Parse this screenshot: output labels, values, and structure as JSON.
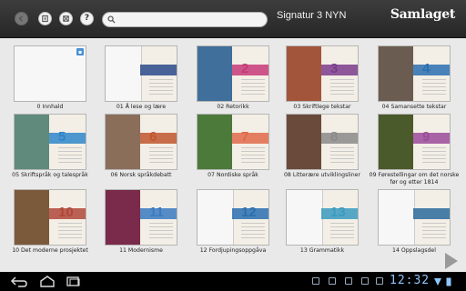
{
  "header": {
    "book_title": "Signatur 3 NYN",
    "brand": "Samlaget",
    "search": {
      "value": "",
      "placeholder": ""
    },
    "icons": [
      "back-icon",
      "bookmark-icon",
      "tools-icon",
      "help-icon"
    ],
    "help_glyph": "?"
  },
  "chapters": [
    {
      "label": "0 Innhald",
      "num": "",
      "style": "blank",
      "cover": "#f7f7f7",
      "accent": "#ffffff"
    },
    {
      "label": "01 Å lese og lære",
      "num": "",
      "style": "halfpage",
      "cover": "#f7f7f7",
      "accent": "#2a4a8a"
    },
    {
      "label": "02 Retorikk",
      "num": "2",
      "style": "photo",
      "cover": "#3f6f9a",
      "accent": "#c53a78"
    },
    {
      "label": "03 Skriftlege tekstar",
      "num": "3",
      "style": "photo",
      "cover": "#a2553a",
      "accent": "#7a3c8c"
    },
    {
      "label": "04 Samansette tekstar",
      "num": "4",
      "style": "photo",
      "cover": "#6a5c50",
      "accent": "#2a6fb0"
    },
    {
      "label": "05 Skriftspråk og talespråk",
      "num": "5",
      "style": "photo",
      "cover": "#5f8a7c",
      "accent": "#2f86c9"
    },
    {
      "label": "06 Norsk språkdebatt",
      "num": "6",
      "style": "photo",
      "cover": "#8a6e5a",
      "accent": "#c0562e"
    },
    {
      "label": "07 Nordiske språk",
      "num": "7",
      "style": "photo",
      "cover": "#4b7a3a",
      "accent": "#e06a4a"
    },
    {
      "label": "08 Litterære utviklingsliner",
      "num": "8",
      "style": "photo",
      "cover": "#6a4a3a",
      "accent": "#8a8a8a"
    },
    {
      "label": "09 Førestellingar om det norske før og etter 1814",
      "num": "9",
      "style": "photo",
      "cover": "#4a5a2a",
      "accent": "#9a4a9a"
    },
    {
      "label": "10 Det moderne prosjektet",
      "num": "10",
      "style": "photo",
      "cover": "#7a5a3a",
      "accent": "#b0463a"
    },
    {
      "label": "11 Modernisme",
      "num": "11",
      "style": "photo",
      "cover": "#7a2a4a",
      "accent": "#3a7ac0"
    },
    {
      "label": "12 Fordjupingsoppgåva",
      "num": "12",
      "style": "halfpage",
      "cover": "#f7f7f7",
      "accent": "#2a6fb0"
    },
    {
      "label": "13 Grammatikk",
      "num": "13",
      "style": "halfpage",
      "cover": "#f7f7f7",
      "accent": "#3a9ac0"
    },
    {
      "label": "14 Oppslagsdel",
      "num": "",
      "style": "halfpage",
      "cover": "#f7f7f7",
      "accent": "#2a6a9a"
    }
  ],
  "system_bar": {
    "clock": "12:32",
    "nav_icons": [
      "back-nav-icon",
      "home-nav-icon",
      "recent-apps-icon"
    ],
    "tray_icons": [
      "tray-checkbox-icon-1",
      "tray-checkbox-icon-2",
      "tray-checkbox-icon-3",
      "tray-checkbox-icon-4",
      "tray-checkbox-icon-5",
      "tray-checkbox-icon-6"
    ]
  },
  "colors": {
    "topbar": "#2e2e2e",
    "background": "#e9e9e9",
    "clock": "#8ec7ff",
    "badge": "#4a90d6"
  }
}
